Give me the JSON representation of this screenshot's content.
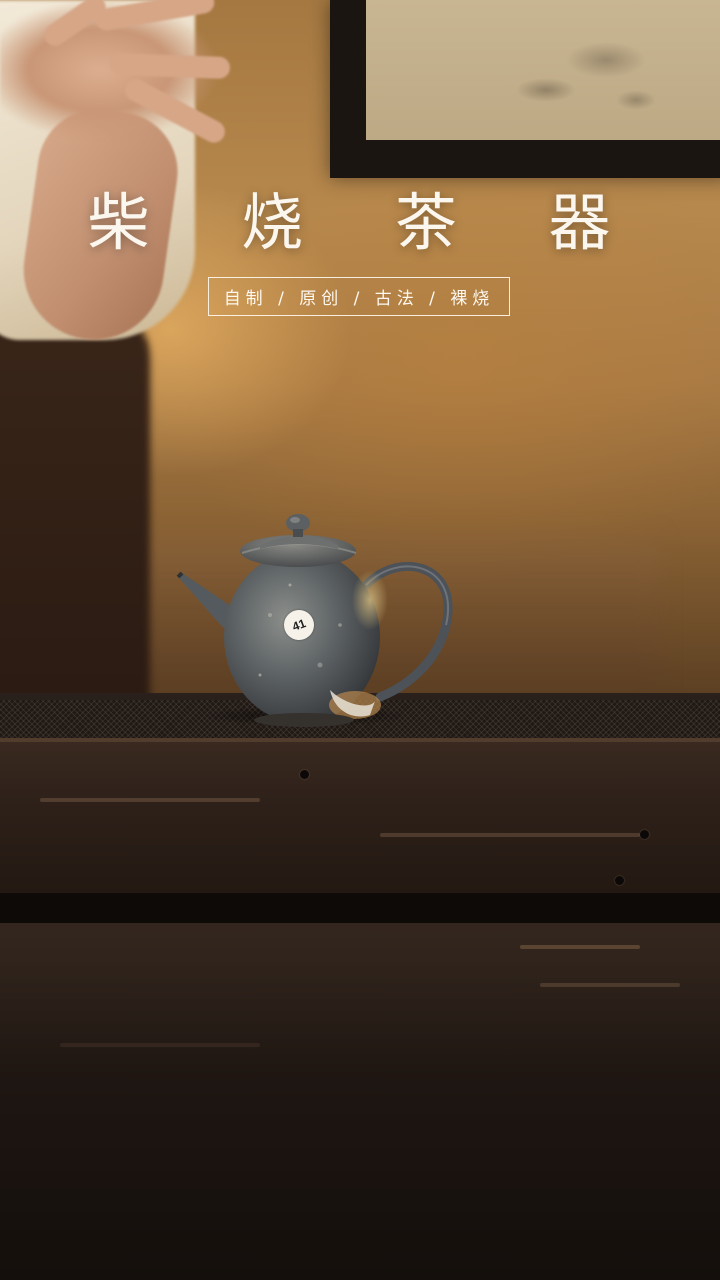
{
  "title": "柴 烧 茶 器",
  "subtitle": "自制 / 原创 / 古法 / 裸烧",
  "teapot_tag": "41",
  "colors": {
    "title_text": "#fbf6ee",
    "wall_warm": "#b6884d",
    "table_dark": "#2d2019",
    "teapot_glaze": "#5f6466"
  }
}
